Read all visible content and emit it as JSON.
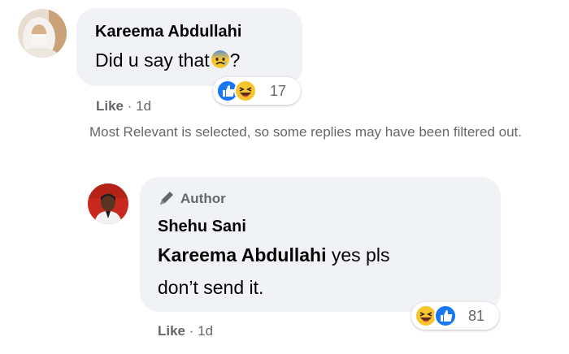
{
  "comment": {
    "author": "Kareema Abdullahi",
    "text": "Did u say that",
    "text_suffix": "?",
    "reaction_count": "17",
    "like_label": "Like",
    "time": "1d",
    "separator": "·"
  },
  "notice": "Most Relevant is selected, so some replies may have been filtered out.",
  "reply": {
    "badge": "Author",
    "author": "Shehu Sani",
    "mention": "Kareema Abdullahi",
    "text_line1": "yes pls",
    "text_line2": "don’t send it.",
    "reaction_count": "81",
    "like_label": "Like",
    "time": "1d",
    "separator": "·"
  },
  "colors": {
    "bubble": "#f0f2f5",
    "secondary_text": "#65676b",
    "like_blue": "#1877f2",
    "haha_yellow": "#f7c62e"
  },
  "icons": [
    "avatar",
    "anxious-face-emoji",
    "like-icon",
    "haha-icon",
    "pencil-icon"
  ]
}
